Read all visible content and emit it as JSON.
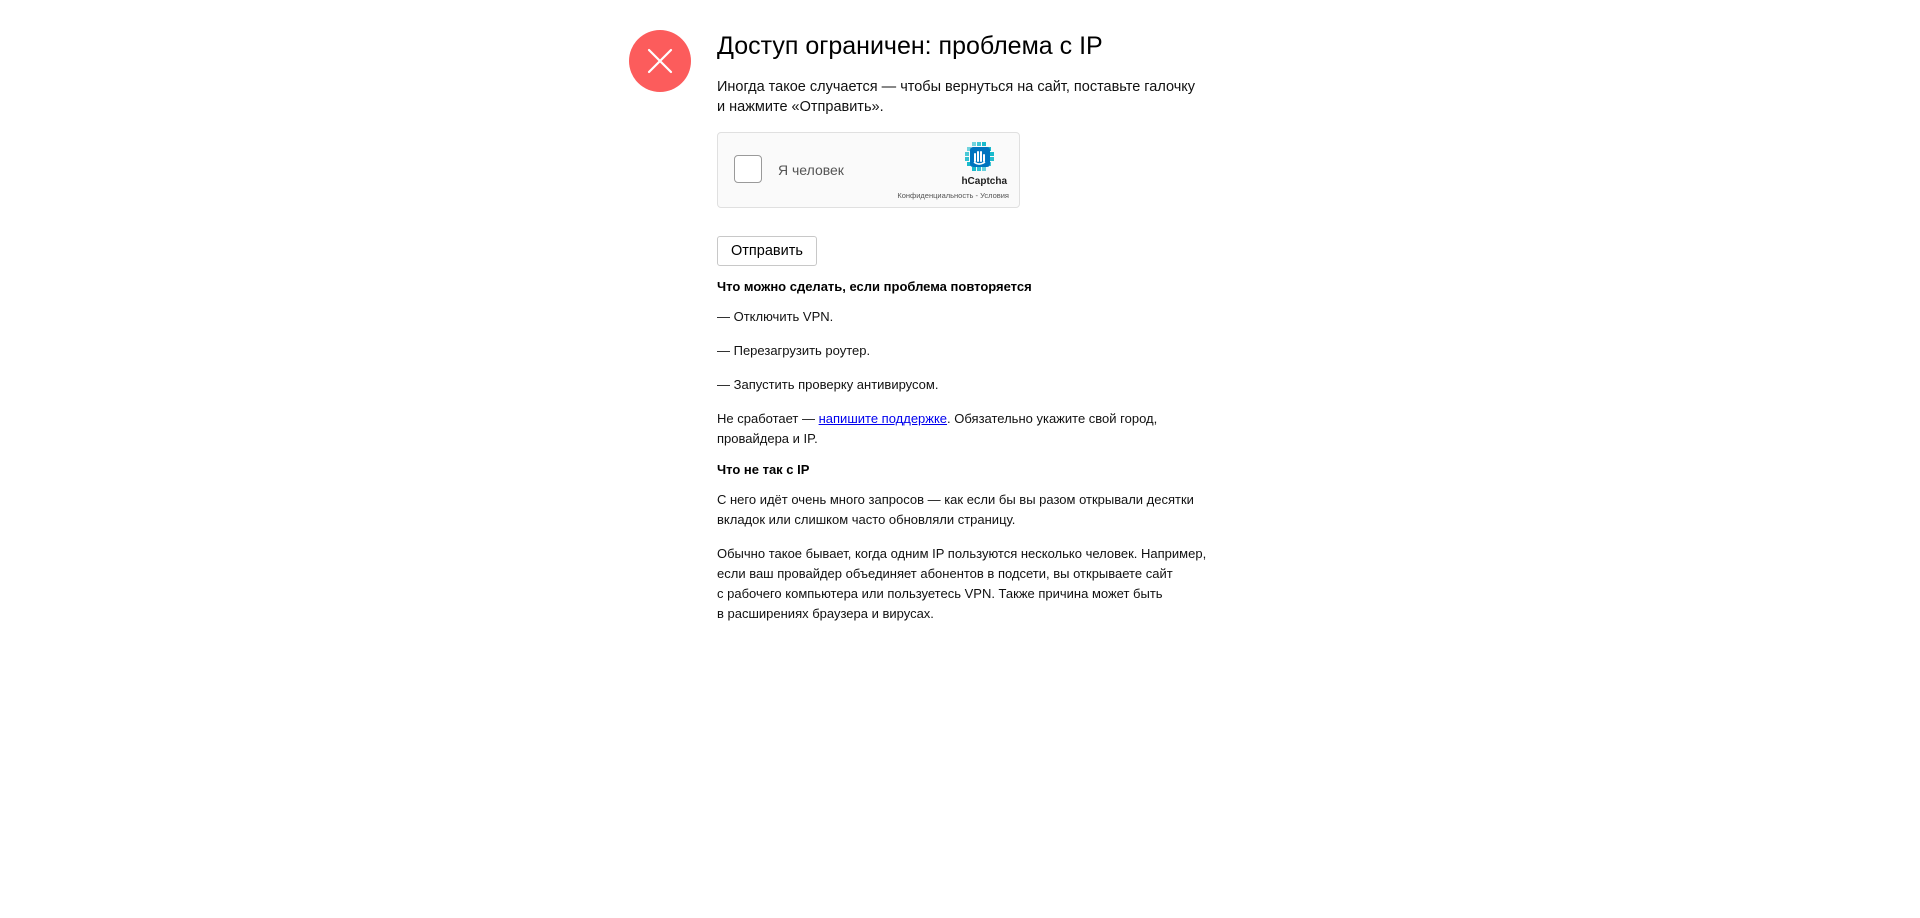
{
  "page": {
    "title": "Доступ ограничен: проблема с IP",
    "intro_line1": "Иногда такое случается — чтобы вернуться на сайт, поставьте галочку",
    "intro_line2": "и нажмите «Отправить»."
  },
  "captcha": {
    "label": "Я человек",
    "brand": "hCaptcha",
    "privacy_link": "Конфиденциальность",
    "separator": " - ",
    "terms_link": "Условия",
    "checked": false,
    "logo_color": "#0074bf",
    "logo_accent": "#00c8d2"
  },
  "form": {
    "submit_label": "Отправить"
  },
  "help": {
    "heading": "Что можно сделать, если проблема повторяется",
    "steps": [
      "— Отключить VPN.",
      "— Перезагрузить роутер.",
      "— Запустить проверку антивирусом."
    ],
    "fallback_prefix": "Не сработает — ",
    "support_link": "напишите поддержке",
    "fallback_suffix_line1": ". Обязательно укажите свой город,",
    "fallback_suffix_line2": "провайдера и IP."
  },
  "explain": {
    "heading": "Что не так с IP",
    "para1_line1": "С него идёт очень много запросов — как если бы вы разом открывали десятки",
    "para1_line2": "вкладок или слишком часто обновляли страницу.",
    "para2_line1": "Обычно такое бывает, когда одним IP пользуются несколько человек. Например,",
    "para2_line2": "если ваш провайдер объединяет абонентов в подсети, вы открываете сайт",
    "para2_line3": "с рабочего компьютера или пользуетесь VPN. Также причина может быть",
    "para2_line4": "в расширениях браузера и вирусах."
  },
  "colors": {
    "error_icon_bg": "#fc5c5c",
    "link": "#0000ee"
  }
}
